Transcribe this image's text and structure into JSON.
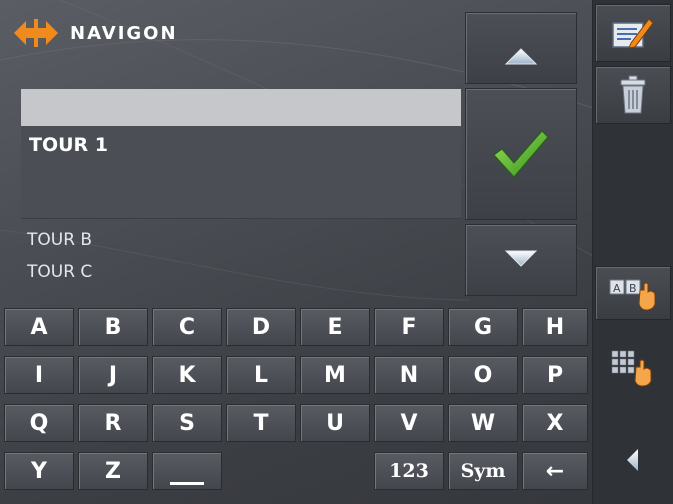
{
  "app": {
    "brand": "NAVIGON"
  },
  "list": {
    "selected": "TOUR 1",
    "items": [
      "TOUR B",
      "TOUR C"
    ]
  },
  "buttons": {
    "scroll_up_icon": "triangle-up-icon",
    "confirm_icon": "checkmark-icon",
    "scroll_down_icon": "triangle-down-icon"
  },
  "sidebar": {
    "items": [
      "edit-note-icon",
      "trash-icon",
      "alphabet-keyboard-icon",
      "numeric-keyboard-icon",
      "back-icon"
    ]
  },
  "keyboard": {
    "rows": [
      [
        "A",
        "B",
        "C",
        "D",
        "E",
        "F",
        "G",
        "H"
      ],
      [
        "I",
        "J",
        "K",
        "L",
        "M",
        "N",
        "O",
        "P"
      ],
      [
        "Q",
        "R",
        "S",
        "T",
        "U",
        "V",
        "W",
        "X"
      ]
    ],
    "last_row": {
      "y": "Y",
      "z": "Z",
      "space": "",
      "numbers": "123",
      "symbols": "Sym",
      "backspace": "←"
    }
  },
  "colors": {
    "accent_orange": "#f08a1c",
    "check_green": "#5ab52a"
  }
}
